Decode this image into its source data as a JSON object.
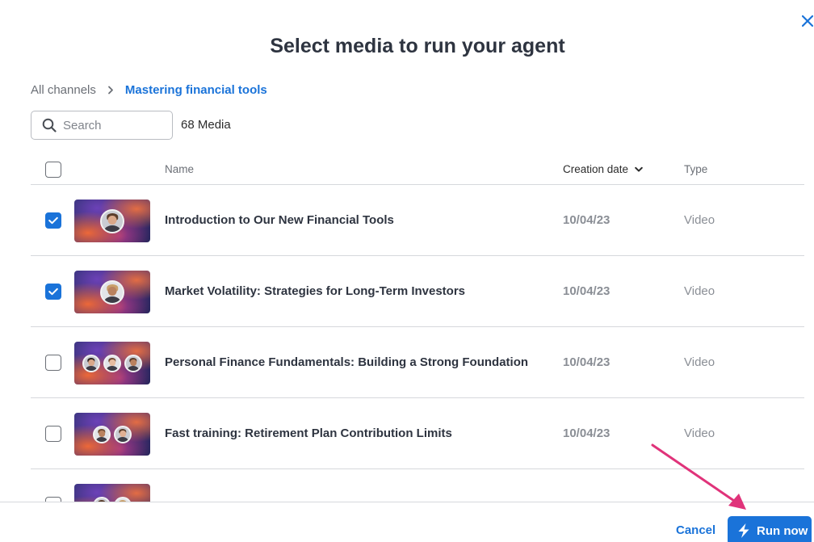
{
  "dialog": {
    "title": "Select media to run your agent",
    "close_icon": "close-icon"
  },
  "breadcrumb": {
    "root": "All channels",
    "separator_icon": "chevron-right-icon",
    "current": "Mastering financial tools"
  },
  "search": {
    "placeholder": "Search",
    "value": "",
    "icon": "search-icon"
  },
  "media_count": "68 Media",
  "table": {
    "columns": {
      "name": "Name",
      "creation_date": "Creation date",
      "type": "Type"
    },
    "sort_icon": "chevron-down-icon",
    "rows": [
      {
        "name": "Introduction to Our New Financial Tools",
        "date": "10/04/23",
        "type": "Video",
        "checked": true,
        "faces": 1
      },
      {
        "name": "Market Volatility: Strategies for Long-Term Investors",
        "date": "10/04/23",
        "type": "Video",
        "checked": true,
        "faces": 1
      },
      {
        "name": "Personal Finance Fundamentals: Building a Strong Foundation",
        "date": "10/04/23",
        "type": "Video",
        "checked": false,
        "faces": 3
      },
      {
        "name": "Fast training: Retirement Plan Contribution Limits",
        "date": "10/04/23",
        "type": "Video",
        "checked": false,
        "faces": 2
      },
      {
        "name": "",
        "date": "",
        "type": "",
        "checked": false,
        "faces": 2
      }
    ]
  },
  "footer": {
    "cancel_label": "Cancel",
    "run_label": "Run now",
    "run_icon": "lightning-icon"
  },
  "colors": {
    "accent": "#1a73d9",
    "annotation_arrow": "#e0337a"
  }
}
